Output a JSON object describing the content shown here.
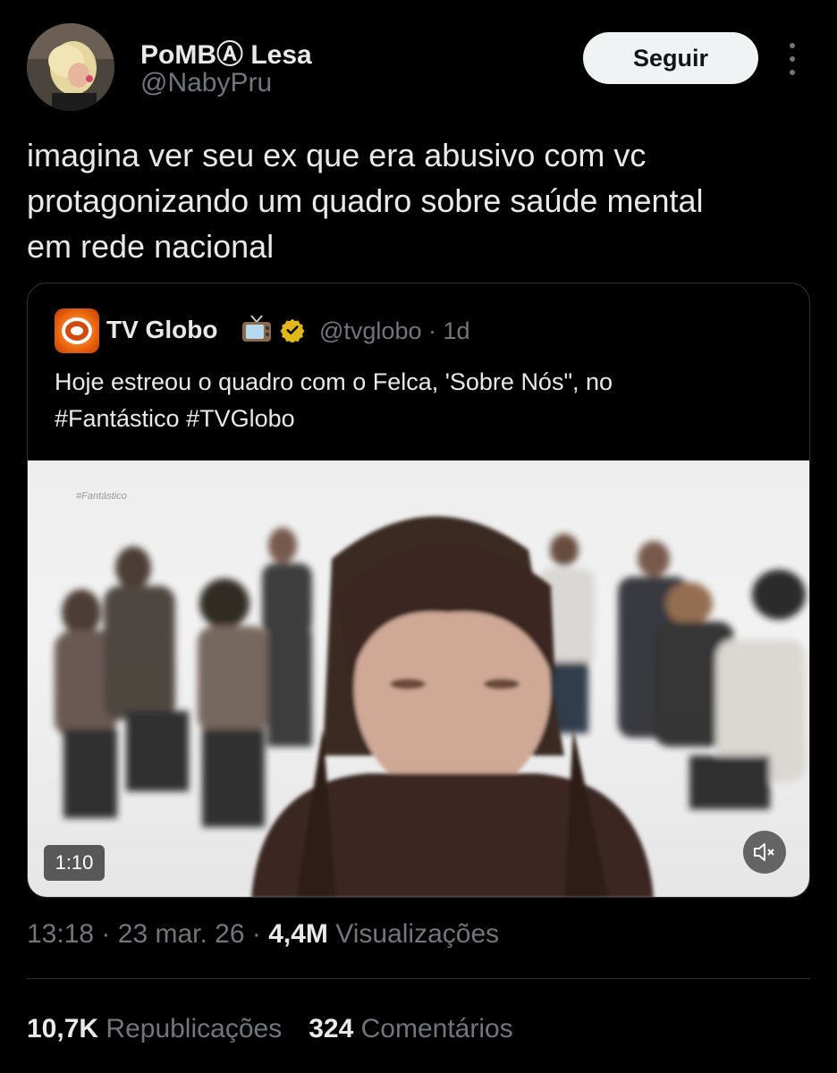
{
  "author": {
    "display_name": "PoMBⒶ Lesa",
    "handle": "@NabyPru",
    "follow_label": "Seguir"
  },
  "tweet": {
    "text": "imagina ver seu ex que era abusivo com vc\nprotagonizando um quadro sobre saúde mental\nem rede nacional"
  },
  "quote": {
    "name": "TV Globo",
    "handle": "@tvglobo",
    "separator": "·",
    "time": "1d",
    "text": "Hoje estreou o quadro com o Felca, 'Sobre Nós\", no\n#Fantástico #TVGlobo",
    "video": {
      "watermark": "#Fantástico",
      "duration": "1:10"
    }
  },
  "meta": {
    "time": "13:18",
    "sep1": "·",
    "date": "23 mar. 26",
    "sep2": "·",
    "views_count": "4,4M",
    "views_label": "Visualizações"
  },
  "stats": {
    "reposts_count": "10,7K",
    "reposts_label": "Republicações",
    "comments_count": "324",
    "comments_label": "Comentários"
  },
  "colors": {
    "background": "#000000",
    "text": "#e7e9ea",
    "secondary": "#71767b",
    "border": "#2f3336",
    "verified_gold": "#e2b719"
  }
}
